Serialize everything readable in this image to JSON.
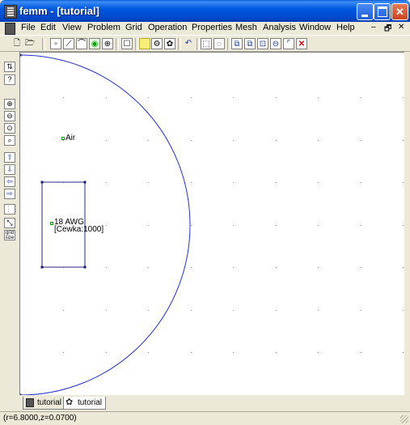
{
  "window": {
    "title": "femm - [tutorial]",
    "minimize_label": "_",
    "close_label": "✕"
  },
  "menu": {
    "items": [
      "File",
      "Edit",
      "View",
      "Problem",
      "Grid",
      "Operation",
      "Properties",
      "Mesh",
      "Analysis",
      "Window",
      "Help"
    ],
    "mdi_minimize": "–",
    "mdi_restore": "🗗",
    "mdi_close": "✕"
  },
  "canvas": {
    "labels": {
      "air": "Air",
      "coil_material": "18 AWG",
      "coil_circuit": "[Cewka:1000]"
    },
    "colors": {
      "boundary_arc": "#2233cc",
      "block": "#2a2a8a",
      "node": "#1a1a6a",
      "label_marker": "#00a000",
      "grid_dot": "#909090"
    }
  },
  "tabs": [
    {
      "label": "tutorial",
      "icon": "femm-doc-icon"
    },
    {
      "label": "tutorial",
      "icon": "mesh-doc-icon"
    }
  ],
  "status": {
    "coordinates": "(r=6.8000,z=0.0700)"
  }
}
